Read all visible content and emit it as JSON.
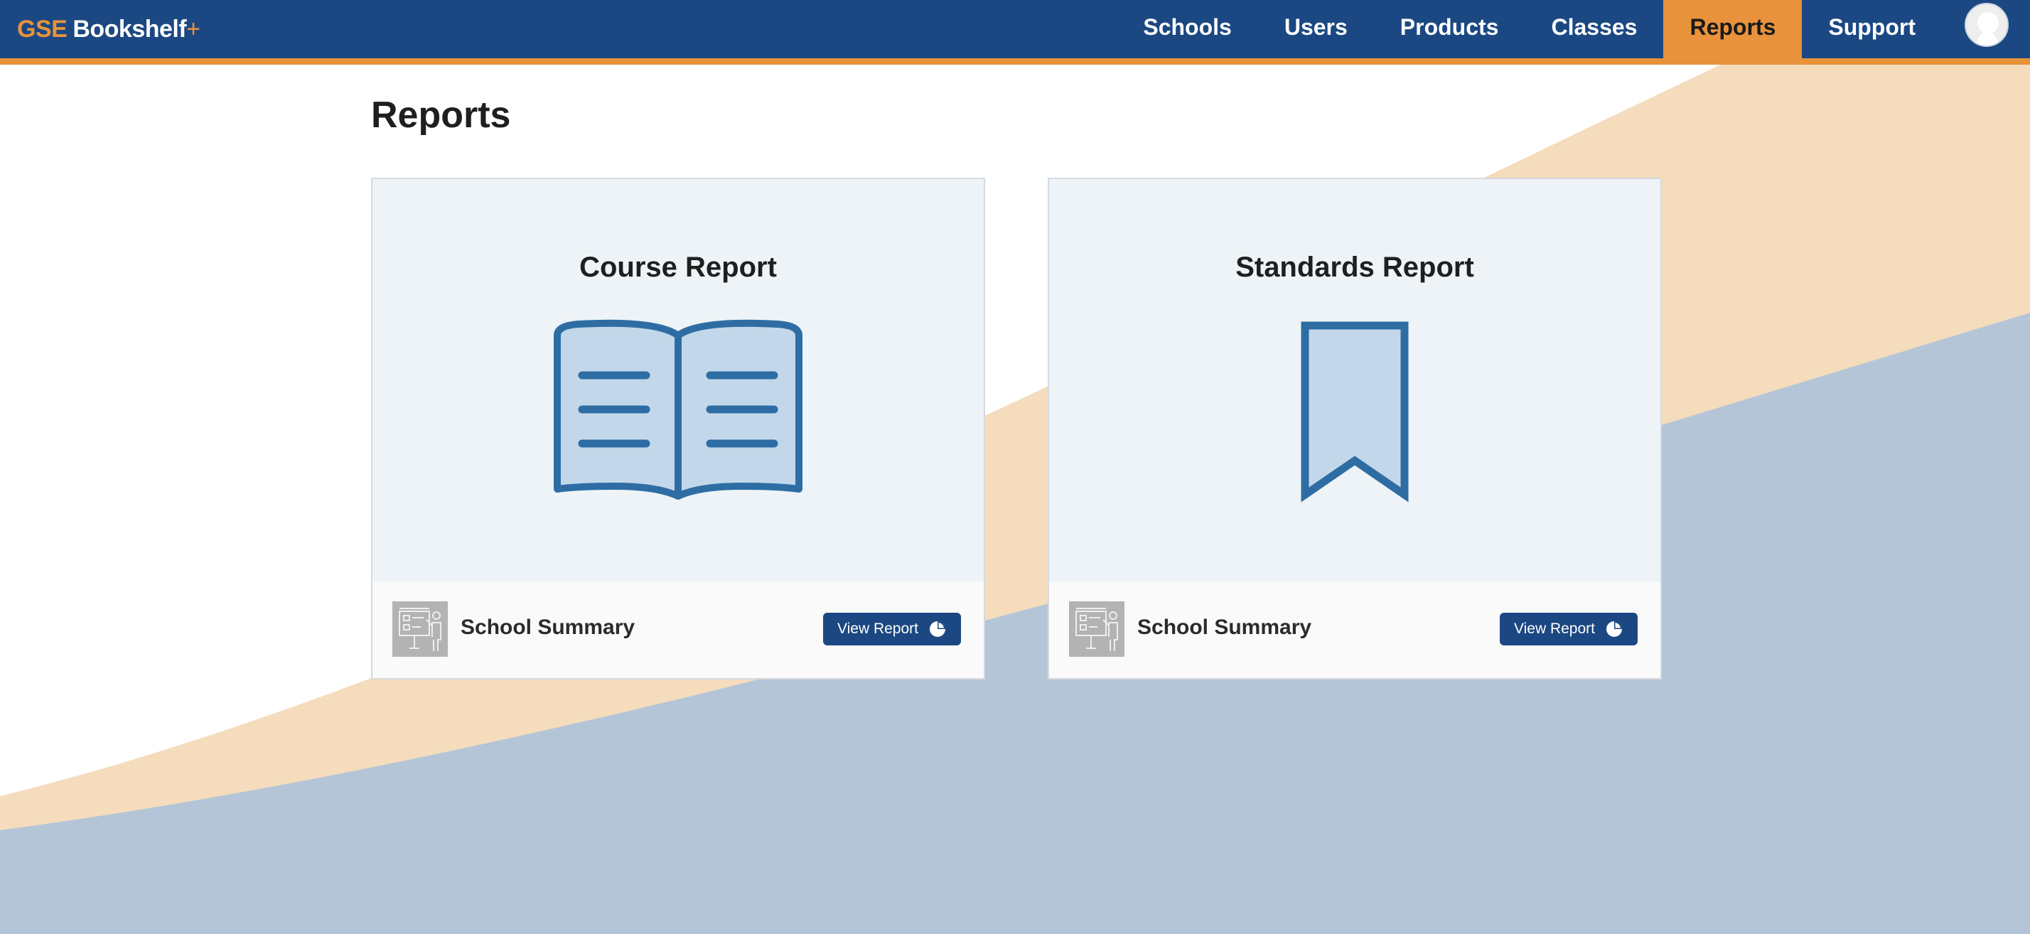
{
  "brand": {
    "part1": "GSE",
    "part2": "Bookshelf",
    "plus": "+"
  },
  "nav": {
    "items": [
      {
        "label": "Schools"
      },
      {
        "label": "Users"
      },
      {
        "label": "Products"
      },
      {
        "label": "Classes"
      },
      {
        "label": "Reports",
        "active": true
      },
      {
        "label": "Support"
      }
    ]
  },
  "page": {
    "title": "Reports"
  },
  "cards": [
    {
      "title": "Course Report",
      "icon": "open-book-icon",
      "summary_label": "School Summary",
      "button_label": "View Report",
      "thumb_icon": "teacher-presentation-icon",
      "button_icon": "pie-chart-icon"
    },
    {
      "title": "Standards Report",
      "icon": "bookmark-icon",
      "summary_label": "School Summary",
      "button_label": "View Report",
      "thumb_icon": "teacher-presentation-icon",
      "button_icon": "pie-chart-icon"
    }
  ],
  "colors": {
    "header": "#1b4882",
    "accent": "#e8923b",
    "card_top": "#edf3f7",
    "icon_stroke": "#2e6da4",
    "icon_fill": "#c2d8ea",
    "bg_wave_orange": "#f4dcbc",
    "bg_wave_blue": "#b4c5d8"
  }
}
